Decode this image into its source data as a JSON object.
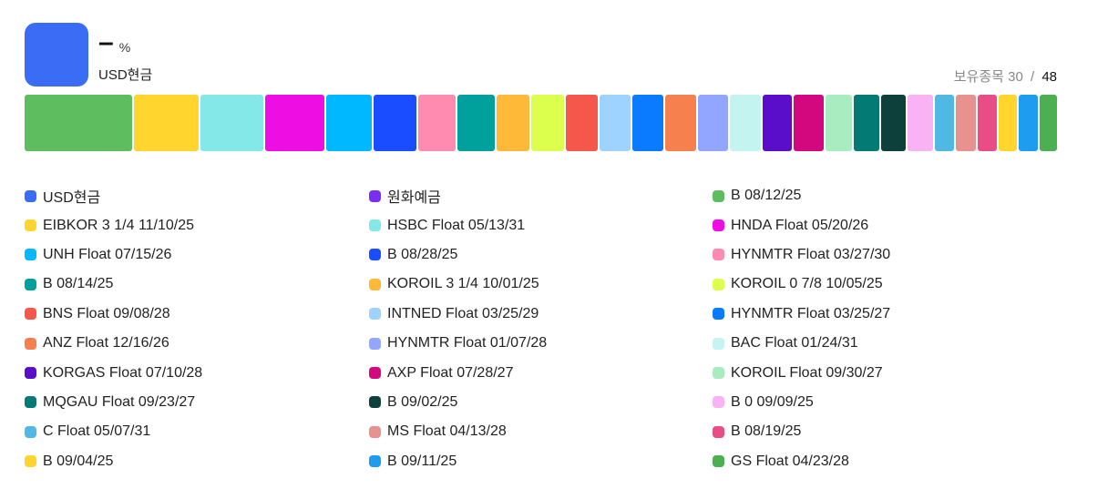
{
  "summary": {
    "percent": "–",
    "unit": "%",
    "name": "USD현금",
    "color": "#3b6cf5"
  },
  "holdings": {
    "label": "보유종목",
    "held": "30",
    "separator": "/",
    "total": "48"
  },
  "bar_segments": [
    {
      "color": "#5ebd5f",
      "share": 116
    },
    {
      "color": "#ffd52e",
      "share": 70
    },
    {
      "color": "#85e8e8",
      "share": 67
    },
    {
      "color": "#ee0ee4",
      "share": 64
    },
    {
      "color": "#00b8ff",
      "share": 49
    },
    {
      "color": "#1a4dff",
      "share": 47
    },
    {
      "color": "#ff8cb0",
      "share": 40
    },
    {
      "color": "#00a19c",
      "share": 40
    },
    {
      "color": "#ffb938",
      "share": 36
    },
    {
      "color": "#dcff4d",
      "share": 35
    },
    {
      "color": "#f5584a",
      "share": 34
    },
    {
      "color": "#9fd3ff",
      "share": 34
    },
    {
      "color": "#0a7bff",
      "share": 33
    },
    {
      "color": "#f7804f",
      "share": 33
    },
    {
      "color": "#93a6ff",
      "share": 33
    },
    {
      "color": "#c4f4ef",
      "share": 33
    },
    {
      "color": "#5a0ec9",
      "share": 32
    },
    {
      "color": "#d4087e",
      "share": 32
    },
    {
      "color": "#a8ecc0",
      "share": 29
    },
    {
      "color": "#037a73",
      "share": 27
    },
    {
      "color": "#0e403b",
      "share": 27
    },
    {
      "color": "#f9b3f5",
      "share": 27
    },
    {
      "color": "#4fb9e3",
      "share": 21
    },
    {
      "color": "#e89290",
      "share": 21
    },
    {
      "color": "#e84d88",
      "share": 21
    },
    {
      "color": "#ffd52e",
      "share": 20
    },
    {
      "color": "#1d9cf0",
      "share": 20
    },
    {
      "color": "#4caf50",
      "share": 19
    }
  ],
  "legend": [
    {
      "label": "USD현금",
      "color": "#3b6cf5"
    },
    {
      "label": "원화예금",
      "color": "#7a2ff0"
    },
    {
      "label": "B 08/12/25",
      "color": "#5ebd5f"
    },
    {
      "label": "EIBKOR 3 1/4 11/10/25",
      "color": "#ffd52e"
    },
    {
      "label": "HSBC Float 05/13/31",
      "color": "#85e8e8"
    },
    {
      "label": "HNDA Float 05/20/26",
      "color": "#ee0ee4"
    },
    {
      "label": "UNH Float 07/15/26",
      "color": "#00b8ff"
    },
    {
      "label": "B 08/28/25",
      "color": "#1a4dff"
    },
    {
      "label": "HYNMTR Float 03/27/30",
      "color": "#ff8cb0"
    },
    {
      "label": "B 08/14/25",
      "color": "#00a19c"
    },
    {
      "label": "KOROIL 3 1/4 10/01/25",
      "color": "#ffb938"
    },
    {
      "label": "KOROIL 0 7/8 10/05/25",
      "color": "#dcff4d"
    },
    {
      "label": "BNS Float 09/08/28",
      "color": "#f5584a"
    },
    {
      "label": "INTNED Float 03/25/29",
      "color": "#9fd3ff"
    },
    {
      "label": "HYNMTR Float 03/25/27",
      "color": "#0a7bff"
    },
    {
      "label": "ANZ Float 12/16/26",
      "color": "#f7804f"
    },
    {
      "label": "HYNMTR Float 01/07/28",
      "color": "#93a6ff"
    },
    {
      "label": "BAC Float 01/24/31",
      "color": "#c4f4ef"
    },
    {
      "label": "KORGAS Float 07/10/28",
      "color": "#5a0ec9"
    },
    {
      "label": "AXP Float 07/28/27",
      "color": "#d4087e"
    },
    {
      "label": "KOROIL Float 09/30/27",
      "color": "#a8ecc0"
    },
    {
      "label": "MQGAU Float 09/23/27",
      "color": "#037a73"
    },
    {
      "label": "B 09/02/25",
      "color": "#0e403b"
    },
    {
      "label": "B 0 09/09/25",
      "color": "#f9b3f5"
    },
    {
      "label": "C Float 05/07/31",
      "color": "#4fb9e3"
    },
    {
      "label": "MS Float 04/13/28",
      "color": "#e89290"
    },
    {
      "label": "B 08/19/25",
      "color": "#e84d88"
    },
    {
      "label": "B 09/04/25",
      "color": "#ffd52e"
    },
    {
      "label": "B 09/11/25",
      "color": "#1d9cf0"
    },
    {
      "label": "GS Float 04/23/28",
      "color": "#4caf50"
    }
  ]
}
